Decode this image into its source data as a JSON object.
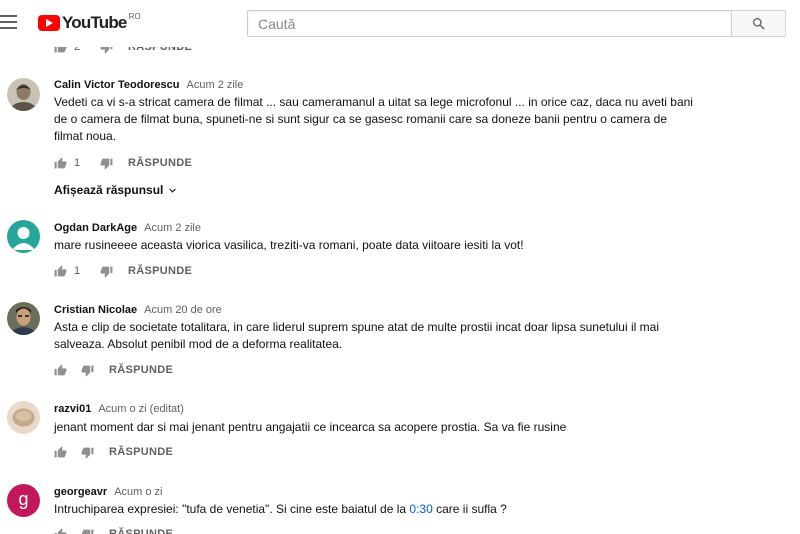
{
  "header": {
    "logo_text": "YouTube",
    "country_code": "RO",
    "search_placeholder": "Caută"
  },
  "reply_label": "RĂSPUNDE",
  "top_partial": {
    "likes": "2"
  },
  "comments": [
    {
      "author": "Calin Victor Teodorescu",
      "time": "Acum 2 zile",
      "text": "Vedeti ca vi s-a stricat camera de filmat ... sau cameramanul a uitat sa lege microfonul ... in orice caz, daca nu aveti bani de o camera de filmat buna, spuneti-ne si sunt sigur ca se gasesc romanii care sa doneze banii pentru o camera de filmat noua.",
      "likes": "1",
      "show_replies": "Afișează răspunsul"
    },
    {
      "author": "Ogdan DarkAge",
      "time": "Acum 2 zile",
      "text": "mare rusineeee aceasta viorica vasilica, treziti-va romani, poate data viitoare iesiti la vot!",
      "likes": "1"
    },
    {
      "author": "Cristian Nicolae",
      "time": "Acum 20 de ore",
      "text": "Asta e clip de societate totalitara, in care liderul suprem spune atat de multe prostii incat doar lipsa sunetului il mai salveaza. Absolut penibil mod de a deforma realitatea.",
      "likes": ""
    },
    {
      "author": "razvi01",
      "time": "Acum o zi (editat)",
      "text": "jenant moment dar si mai jenant pentru angajatii ce incearca sa acopere prostia. Sa va fie rusine",
      "likes": ""
    },
    {
      "author": "georgeavr",
      "time": "Acum o zi",
      "text_before": "Intruchiparea expresiei: \"tufa de venetia\". Si cine este baiatul de la ",
      "timestamp_link": "0:30",
      "text_after": " care ii sufla ?",
      "avatar_letter": "g",
      "likes": ""
    }
  ],
  "colors": {
    "brand_red": "#ff0000",
    "link_blue": "#065fd4",
    "avatar_teal": "#26a69a",
    "avatar_purple": "#c2185b"
  },
  "icons": [
    "menu-icon",
    "youtube-logo-icon",
    "search-icon",
    "thumb-up-icon",
    "thumb-down-icon",
    "chevron-down-icon"
  ]
}
